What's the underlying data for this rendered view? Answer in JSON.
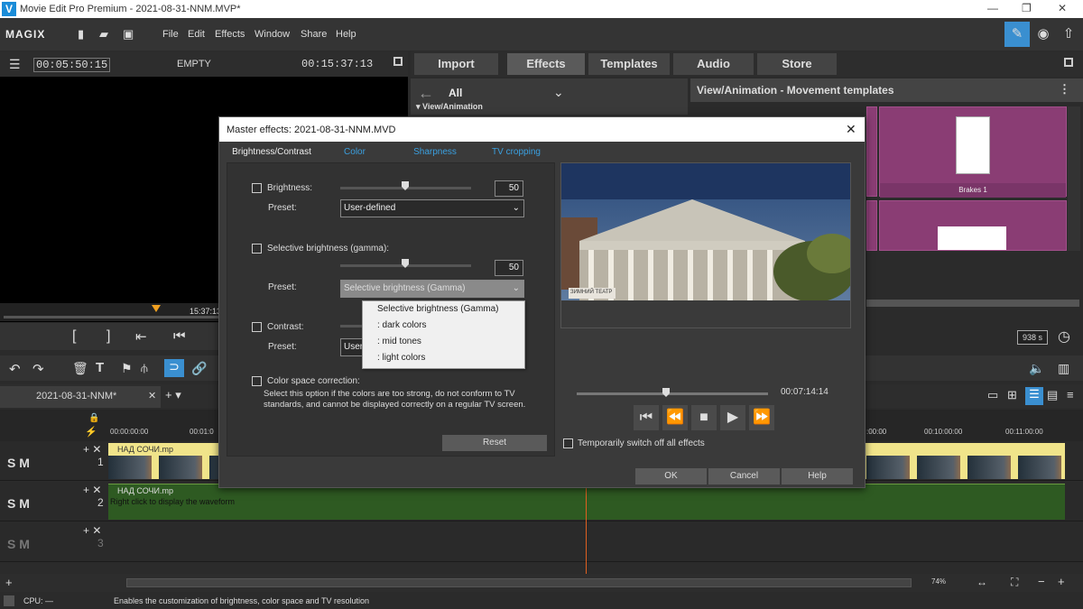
{
  "window": {
    "title": "Movie Edit Pro Premium - 2021-08-31-NNM.MVP*"
  },
  "menu": {
    "brand": "MAGIX",
    "items": [
      "File",
      "Edit",
      "Effects",
      "Window",
      "Share",
      "Help"
    ]
  },
  "preview": {
    "timecode_left": "00:05:50:15",
    "clip_name": "EMPTY",
    "timecode_right": "00:15:37:13",
    "ruler_time": "15:37:13"
  },
  "media_tabs": [
    "Import",
    "Effects",
    "Templates",
    "Audio",
    "Store"
  ],
  "effects_panel": {
    "filter_label": "All",
    "category": "View/Animation",
    "breadcrumb": "View/Animation - Movement templates",
    "tile_label": "Brakes 1"
  },
  "zoom_duration": "938 s",
  "project_tab": "2021-08-31-NNM*",
  "timeline": {
    "ruler_left": [
      "00:00:00:00",
      "00:01:0"
    ],
    "ruler_right": [
      ":00:00",
      "00:10:00:00",
      "00:11:00:00"
    ],
    "tracks": [
      {
        "number": "1",
        "clip": "НАД СОЧИ.mp"
      },
      {
        "number": "2",
        "clip": "НАД СОЧИ.mp",
        "hint": "Right click to display the waveform"
      },
      {
        "number": "3"
      }
    ],
    "zoom": "74%"
  },
  "status": {
    "cpu": "CPU: —",
    "message": "Enables the customization of brightness, color space and TV resolution"
  },
  "dialog": {
    "title": "Master effects: 2021-08-31-NNM.MVD",
    "tabs": [
      "Brightness/Contrast",
      "Color",
      "Sharpness",
      "TV cropping"
    ],
    "brightness": {
      "label": "Brightness:",
      "value": "50",
      "preset_label": "Preset:",
      "preset": "User-defined"
    },
    "gamma": {
      "label": "Selective brightness (gamma):",
      "value": "50",
      "preset_label": "Preset:",
      "preset": "Selective brightness (Gamma)"
    },
    "dropdown_options": [
      "Selective brightness (Gamma)",
      ": dark colors",
      ": mid tones",
      ": light colors"
    ],
    "contrast": {
      "label": "Contrast:",
      "preset_label": "Preset:",
      "preset": "User"
    },
    "color_space": {
      "label": "Color space correction:",
      "description": "Select this option if the colors are too strong, do not conform to TV standards, and cannot be displayed correctly on a regular TV screen."
    },
    "reset": "Reset",
    "video_overlay_text": "ЗИМНИЙ ТЕАТР",
    "position_time": "00:07:14:14",
    "switch_off_label": "Temporarily switch off all effects",
    "ok": "OK",
    "cancel": "Cancel",
    "help": "Help"
  }
}
